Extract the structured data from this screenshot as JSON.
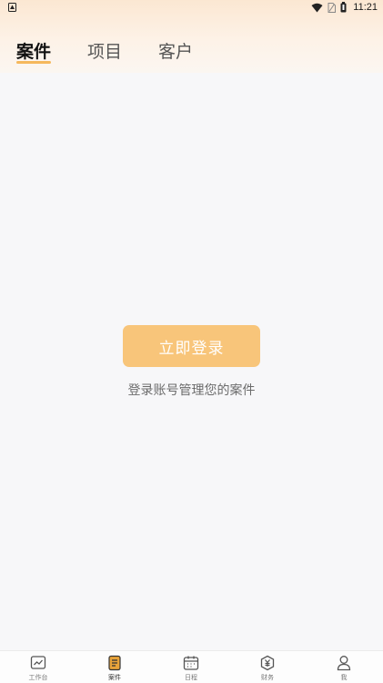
{
  "status_bar": {
    "time": "11:21"
  },
  "top_tabs": [
    {
      "label": "案件",
      "active": true
    },
    {
      "label": "项目",
      "active": false
    },
    {
      "label": "客户",
      "active": false
    }
  ],
  "login": {
    "button_label": "立即登录",
    "hint": "登录账号管理您的案件"
  },
  "bottom_nav": [
    {
      "label": "工作台",
      "icon": "chart-icon",
      "active": false
    },
    {
      "label": "案件",
      "icon": "document-icon",
      "active": true
    },
    {
      "label": "日程",
      "icon": "calendar-icon",
      "active": false
    },
    {
      "label": "财务",
      "icon": "yuan-icon",
      "active": false
    },
    {
      "label": "我",
      "icon": "person-icon",
      "active": false
    }
  ],
  "colors": {
    "accent": "#f8c57a",
    "accent_dark": "#e8a33a",
    "header_gradient_top": "#fbe7d2",
    "background": "#f7f7f9"
  }
}
